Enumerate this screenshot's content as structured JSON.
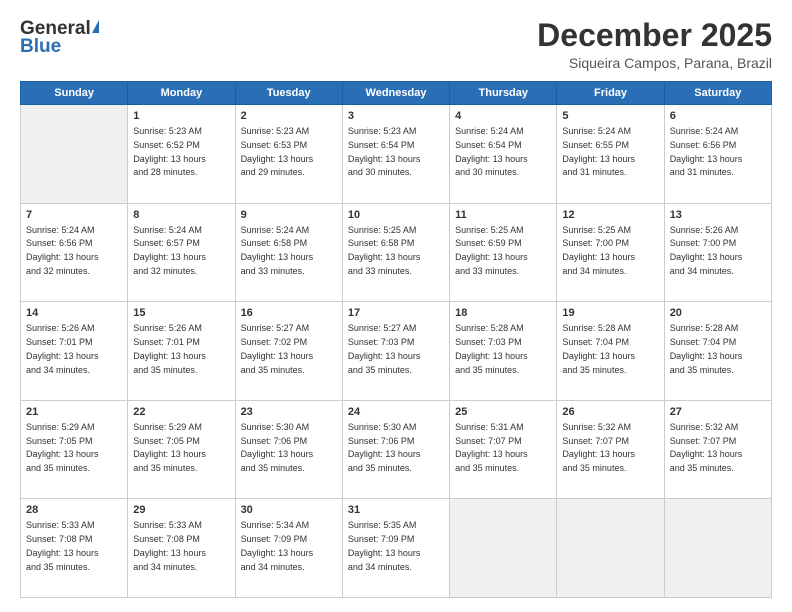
{
  "header": {
    "logo_general": "General",
    "logo_blue": "Blue",
    "title": "December 2025",
    "location": "Siqueira Campos, Parana, Brazil"
  },
  "days_of_week": [
    "Sunday",
    "Monday",
    "Tuesday",
    "Wednesday",
    "Thursday",
    "Friday",
    "Saturday"
  ],
  "weeks": [
    [
      {
        "day": "",
        "empty": true
      },
      {
        "day": "1",
        "sunrise": "5:23 AM",
        "sunset": "6:52 PM",
        "daylight": "13 hours and 28 minutes."
      },
      {
        "day": "2",
        "sunrise": "5:23 AM",
        "sunset": "6:53 PM",
        "daylight": "13 hours and 29 minutes."
      },
      {
        "day": "3",
        "sunrise": "5:23 AM",
        "sunset": "6:54 PM",
        "daylight": "13 hours and 30 minutes."
      },
      {
        "day": "4",
        "sunrise": "5:24 AM",
        "sunset": "6:54 PM",
        "daylight": "13 hours and 30 minutes."
      },
      {
        "day": "5",
        "sunrise": "5:24 AM",
        "sunset": "6:55 PM",
        "daylight": "13 hours and 31 minutes."
      },
      {
        "day": "6",
        "sunrise": "5:24 AM",
        "sunset": "6:56 PM",
        "daylight": "13 hours and 31 minutes."
      }
    ],
    [
      {
        "day": "7",
        "sunrise": "5:24 AM",
        "sunset": "6:56 PM",
        "daylight": "13 hours and 32 minutes."
      },
      {
        "day": "8",
        "sunrise": "5:24 AM",
        "sunset": "6:57 PM",
        "daylight": "13 hours and 32 minutes."
      },
      {
        "day": "9",
        "sunrise": "5:24 AM",
        "sunset": "6:58 PM",
        "daylight": "13 hours and 33 minutes."
      },
      {
        "day": "10",
        "sunrise": "5:25 AM",
        "sunset": "6:58 PM",
        "daylight": "13 hours and 33 minutes."
      },
      {
        "day": "11",
        "sunrise": "5:25 AM",
        "sunset": "6:59 PM",
        "daylight": "13 hours and 33 minutes."
      },
      {
        "day": "12",
        "sunrise": "5:25 AM",
        "sunset": "7:00 PM",
        "daylight": "13 hours and 34 minutes."
      },
      {
        "day": "13",
        "sunrise": "5:26 AM",
        "sunset": "7:00 PM",
        "daylight": "13 hours and 34 minutes."
      }
    ],
    [
      {
        "day": "14",
        "sunrise": "5:26 AM",
        "sunset": "7:01 PM",
        "daylight": "13 hours and 34 minutes."
      },
      {
        "day": "15",
        "sunrise": "5:26 AM",
        "sunset": "7:01 PM",
        "daylight": "13 hours and 35 minutes."
      },
      {
        "day": "16",
        "sunrise": "5:27 AM",
        "sunset": "7:02 PM",
        "daylight": "13 hours and 35 minutes."
      },
      {
        "day": "17",
        "sunrise": "5:27 AM",
        "sunset": "7:03 PM",
        "daylight": "13 hours and 35 minutes."
      },
      {
        "day": "18",
        "sunrise": "5:28 AM",
        "sunset": "7:03 PM",
        "daylight": "13 hours and 35 minutes."
      },
      {
        "day": "19",
        "sunrise": "5:28 AM",
        "sunset": "7:04 PM",
        "daylight": "13 hours and 35 minutes."
      },
      {
        "day": "20",
        "sunrise": "5:28 AM",
        "sunset": "7:04 PM",
        "daylight": "13 hours and 35 minutes."
      }
    ],
    [
      {
        "day": "21",
        "sunrise": "5:29 AM",
        "sunset": "7:05 PM",
        "daylight": "13 hours and 35 minutes."
      },
      {
        "day": "22",
        "sunrise": "5:29 AM",
        "sunset": "7:05 PM",
        "daylight": "13 hours and 35 minutes."
      },
      {
        "day": "23",
        "sunrise": "5:30 AM",
        "sunset": "7:06 PM",
        "daylight": "13 hours and 35 minutes."
      },
      {
        "day": "24",
        "sunrise": "5:30 AM",
        "sunset": "7:06 PM",
        "daylight": "13 hours and 35 minutes."
      },
      {
        "day": "25",
        "sunrise": "5:31 AM",
        "sunset": "7:07 PM",
        "daylight": "13 hours and 35 minutes."
      },
      {
        "day": "26",
        "sunrise": "5:32 AM",
        "sunset": "7:07 PM",
        "daylight": "13 hours and 35 minutes."
      },
      {
        "day": "27",
        "sunrise": "5:32 AM",
        "sunset": "7:07 PM",
        "daylight": "13 hours and 35 minutes."
      }
    ],
    [
      {
        "day": "28",
        "sunrise": "5:33 AM",
        "sunset": "7:08 PM",
        "daylight": "13 hours and 35 minutes."
      },
      {
        "day": "29",
        "sunrise": "5:33 AM",
        "sunset": "7:08 PM",
        "daylight": "13 hours and 34 minutes."
      },
      {
        "day": "30",
        "sunrise": "5:34 AM",
        "sunset": "7:09 PM",
        "daylight": "13 hours and 34 minutes."
      },
      {
        "day": "31",
        "sunrise": "5:35 AM",
        "sunset": "7:09 PM",
        "daylight": "13 hours and 34 minutes."
      },
      {
        "day": "",
        "empty": true
      },
      {
        "day": "",
        "empty": true
      },
      {
        "day": "",
        "empty": true
      }
    ]
  ],
  "labels": {
    "sunrise": "Sunrise:",
    "sunset": "Sunset:",
    "daylight": "Daylight:"
  }
}
